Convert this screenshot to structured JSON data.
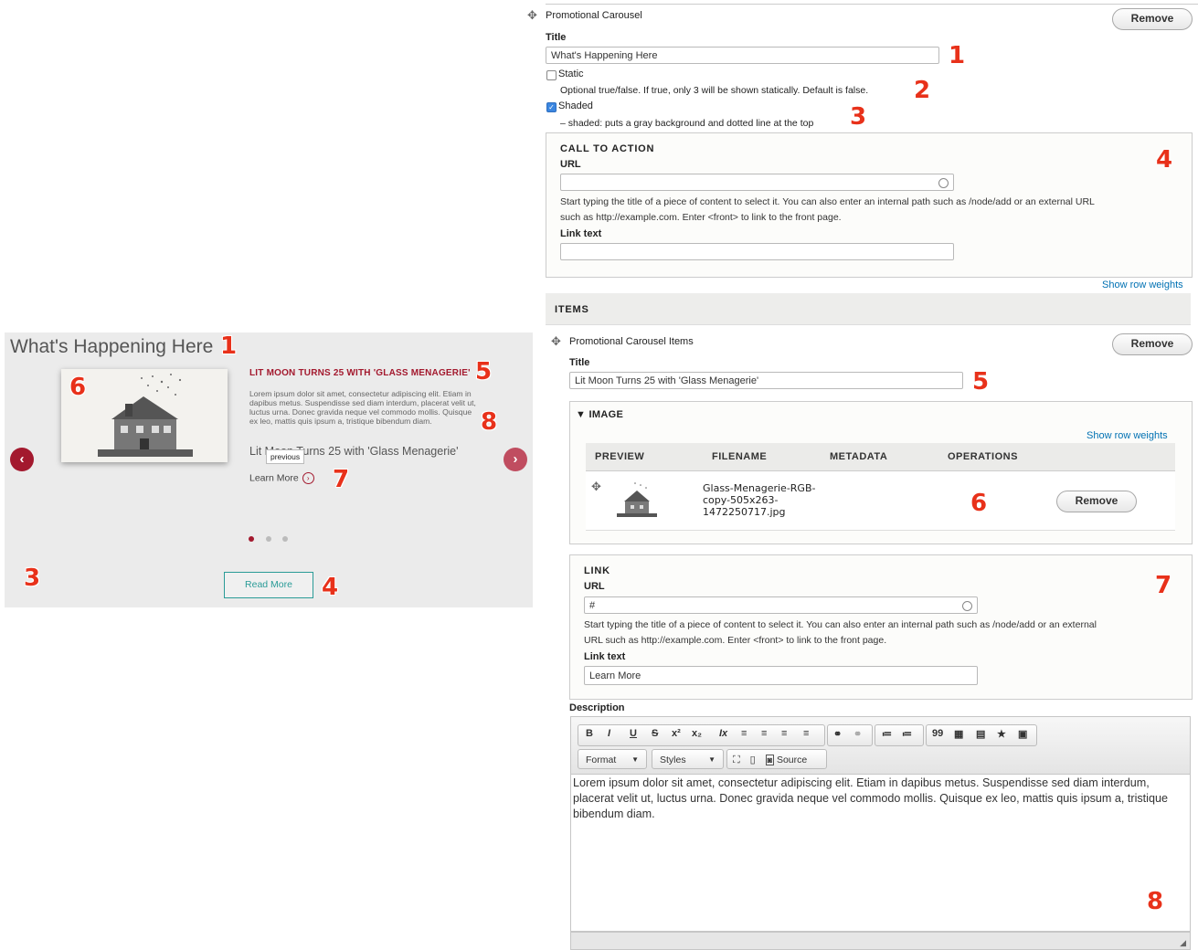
{
  "preview": {
    "title": "What's Happening Here",
    "slide_title": "LIT MOON TURNS 25 WITH 'GLASS MENAGERIE'",
    "body": "Lorem ipsum dolor sit amet, consectetur adipiscing elit. Etiam in dapibus metus. Suspendisse sed diam interdum, placerat velit ut, luctus urna. Donec gravida neque vel commodo mollis. Quisque ex leo, mattis quis ipsum a, tristique bibendum diam.",
    "subtitle": "Lit Moon Turns 25 with 'Glass Menagerie'",
    "tooltip": "previous",
    "learn_more": "Learn More",
    "read_more": "Read More",
    "prev_icon": "chevron-left-icon",
    "next_icon": "chevron-right-icon",
    "dots_total": 3,
    "dot_active": 1,
    "colors": {
      "accent": "#a3192e",
      "teal": "#2a9b97",
      "background": "#ebebeb"
    }
  },
  "form": {
    "section_title": "Promotional Carousel",
    "remove": "Remove",
    "title_label": "Title",
    "title_value": "What's Happening Here",
    "static_label": "Static",
    "static_checked": false,
    "static_hint": "Optional true/false. If true, only 3 will be shown statically. Default is false.",
    "shaded_label": "Shaded",
    "shaded_checked": true,
    "shaded_hint": "– shaded: puts a gray background and dotted line at the top",
    "cta": {
      "legend": "CALL TO ACTION",
      "url_label": "URL",
      "url_value": "",
      "hint_line1": "Start typing the title of a piece of content to select it. You can also enter an internal path such as /node/add or an external URL",
      "hint_line2": "such as http://example.com. Enter <front> to link to the front page.",
      "link_text_label": "Link text",
      "link_text_value": ""
    },
    "show_row_weights": "Show row weights",
    "items_header": "ITEMS",
    "item": {
      "title": "Promotional Carousel Items",
      "remove": "Remove",
      "title_label": "Title",
      "title_value": "Lit Moon Turns 25 with 'Glass Menagerie'",
      "image": {
        "legend": "IMAGE",
        "show_row_weights": "Show row weights",
        "columns": [
          "PREVIEW",
          "FILENAME",
          "METADATA",
          "OPERATIONS"
        ],
        "filename_lines": [
          "Glass-Menagerie-RGB-",
          "copy-505x263-",
          "1472250717.jpg"
        ],
        "remove": "Remove"
      },
      "link": {
        "legend": "LINK",
        "url_label": "URL",
        "url_value": "#",
        "hint_line1": "Start typing the title of a piece of content to select it. You can also enter an internal path such as /node/add or an external",
        "hint_line2": "URL such as http://example.com. Enter <front> to link to the front page.",
        "link_text_label": "Link text",
        "link_text_value": "Learn More"
      },
      "description_label": "Description",
      "editor": {
        "buttons": [
          "B",
          "I",
          "U",
          "S",
          "x²",
          "x₂",
          "Ix",
          "≡",
          "≡",
          "≡",
          "≡",
          "⚭",
          "⚭",
          "≔",
          "≔",
          "99",
          "▦",
          "▤",
          "★",
          "▣"
        ],
        "format": "Format",
        "styles": "Styles",
        "source": "Source",
        "content": "Lorem ipsum dolor sit amet, consectetur adipiscing elit. Etiam in dapibus metus. Suspendisse sed diam interdum, placerat velit ut, luctus urna. Donec gravida neque vel commodo mollis. Quisque ex leo, mattis quis ipsum a, tristique bibendum diam."
      }
    }
  },
  "callouts": [
    "1",
    "2",
    "3",
    "4",
    "5",
    "6",
    "7",
    "8"
  ]
}
